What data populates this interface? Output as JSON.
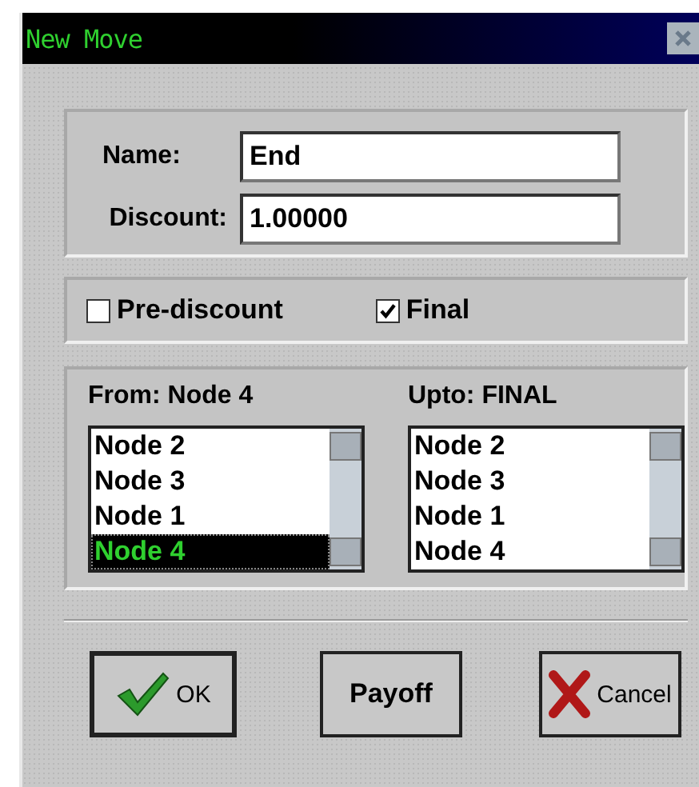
{
  "window": {
    "title": "New Move"
  },
  "fields": [
    {
      "label": "Name:",
      "value": "End"
    },
    {
      "label": "Discount:",
      "value": "1.00000"
    }
  ],
  "options": [
    {
      "label": "Pre-discount",
      "checked": false
    },
    {
      "label": "Final",
      "checked": true
    }
  ],
  "lists": [
    {
      "heading": "From: Node 4",
      "items": [
        {
          "label": "Node 2",
          "selected": false
        },
        {
          "label": "Node 3",
          "selected": false
        },
        {
          "label": "Node 1",
          "selected": false
        },
        {
          "label": "Node 4",
          "selected": true
        }
      ]
    },
    {
      "heading": "Upto: FINAL",
      "items": [
        {
          "label": "Node 2",
          "selected": false
        },
        {
          "label": "Node 3",
          "selected": false
        },
        {
          "label": "Node 1",
          "selected": false
        },
        {
          "label": "Node 4",
          "selected": false
        }
      ]
    }
  ],
  "buttons": [
    {
      "label": "OK",
      "kind": "ok"
    },
    {
      "label": "Payoff",
      "kind": "plain"
    },
    {
      "label": "Cancel",
      "kind": "cancel"
    }
  ]
}
